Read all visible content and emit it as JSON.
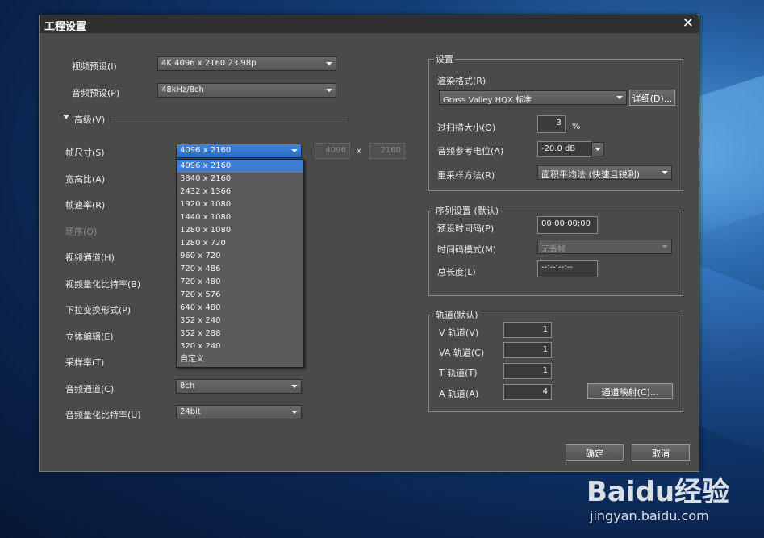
{
  "dialog": {
    "title": "工程设置",
    "close": "✕"
  },
  "presets": {
    "video_label": "视频预设(I)",
    "video_value": "4K 4096 x 2160 23.98p",
    "audio_label": "音频预设(P)",
    "audio_value": "48kHz/8ch"
  },
  "advanced": {
    "label": "高级(V)",
    "frame_size_label": "帧尺寸(S)",
    "frame_size_value": "4096 x 2160",
    "width_value": "4096",
    "height_value": "2160",
    "x_sep": "x",
    "aspect_label": "宽高比(A)",
    "framerate_label": "帧速率(R)",
    "field_order_label": "场序(O)",
    "video_channel_label": "视频通道(H)",
    "video_bitdepth_label": "视频量化比特率(B)",
    "pulldown_label": "下拉变换形式(P)",
    "stereo_label": "立体编辑(E)",
    "samplerate_label": "采样率(T)",
    "audio_channel_label": "音频通道(C)",
    "audio_channel_value": "8ch",
    "audio_bitdepth_label": "音频量化比特率(U)",
    "audio_bitdepth_value": "24bit"
  },
  "frame_size_options": [
    "4096 x 2160",
    "3840 x 2160",
    "2432 x 1366",
    "1920 x 1080",
    "1440 x 1080",
    "1280 x 1080",
    "1280 x 720",
    "960 x 720",
    "720 x 486",
    "720 x 480",
    "720 x 576",
    "640 x 480",
    "352 x 240",
    "352 x 288",
    "320 x 240",
    "自定义"
  ],
  "settings": {
    "group_title": "设置",
    "render_format_label": "渲染格式(R)",
    "render_format_value": "Grass Valley HQX 标准",
    "detail_button": "详细(D)...",
    "overscan_label": "过扫描大小(O)",
    "overscan_value": "3",
    "overscan_unit": "%",
    "audio_ref_label": "音频参考电位(A)",
    "audio_ref_value": "-20.0 dB",
    "resample_label": "重采样方法(R)",
    "resample_value": "面积平均法 (快速且锐利)"
  },
  "sequence": {
    "group_title": "序列设置 (默认)",
    "preset_tc_label": "预设时间码(P)",
    "preset_tc_value": "00:00:00;00",
    "tc_mode_label": "时间码模式(M)",
    "tc_mode_value": "无丢帧",
    "total_length_label": "总长度(L)",
    "total_length_value": "--:--:--:--"
  },
  "tracks": {
    "group_title": "轨道(默认)",
    "v_label": "V 轨道(V)",
    "v_value": "1",
    "va_label": "VA 轨道(C)",
    "va_value": "1",
    "t_label": "T 轨道(T)",
    "t_value": "1",
    "a_label": "A 轨道(A)",
    "a_value": "4",
    "map_button": "通道映射(C)..."
  },
  "footer": {
    "ok": "确定",
    "cancel": "取消"
  },
  "watermark": {
    "logo": "Baidu经验",
    "url": "jingyan.baidu.com"
  }
}
